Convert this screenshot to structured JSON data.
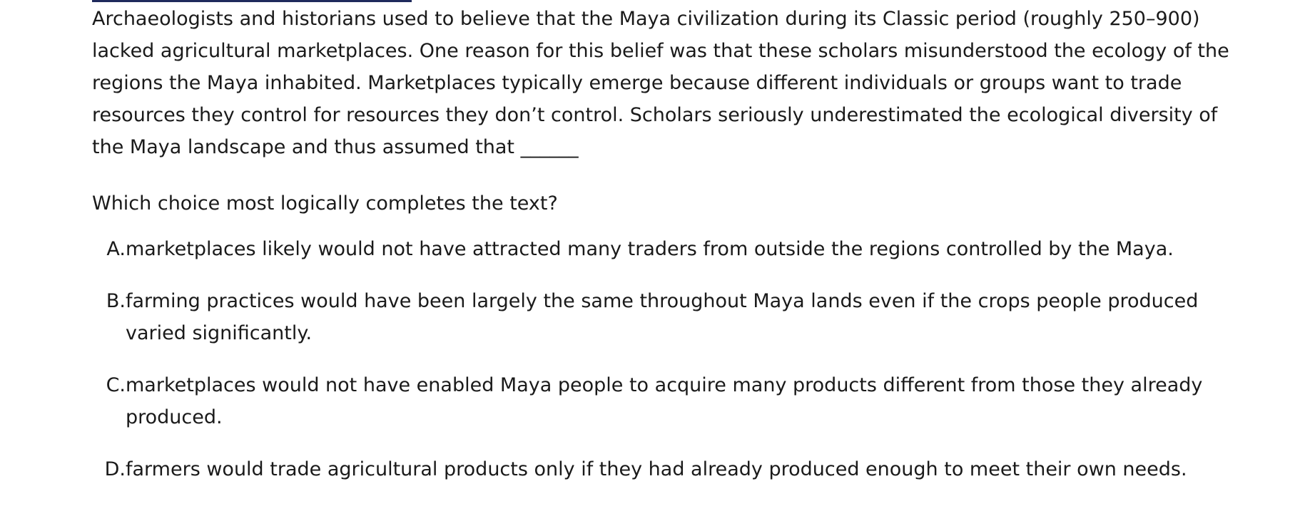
{
  "passage": {
    "text": "Archaeologists and historians used to believe that the Maya civilization during its Classic period (roughly 250–900) lacked agricultural marketplaces. One reason for this belief was that these scholars misunderstood the ecology of the regions the Maya inhabited. Marketplaces typically emerge because different individuals or groups want to trade resources they control for resources they don’t control. Scholars seriously underestimated the ecological diversity of the Maya landscape and thus assumed that ______"
  },
  "question": {
    "prompt": "Which choice most logically completes the text?"
  },
  "choices": [
    {
      "letter": "A.",
      "text": "marketplaces likely would not have attracted many traders from outside the regions controlled by the Maya."
    },
    {
      "letter": "B.",
      "text": "farming practices would have been largely the same throughout Maya lands even if the crops people produced varied significantly."
    },
    {
      "letter": "C.",
      "text": "marketplaces would not have enabled Maya people to acquire many products different from those they already produced."
    },
    {
      "letter": "D.",
      "text": "farmers would trade agricultural products only if they had already produced enough to meet their own needs."
    }
  ]
}
